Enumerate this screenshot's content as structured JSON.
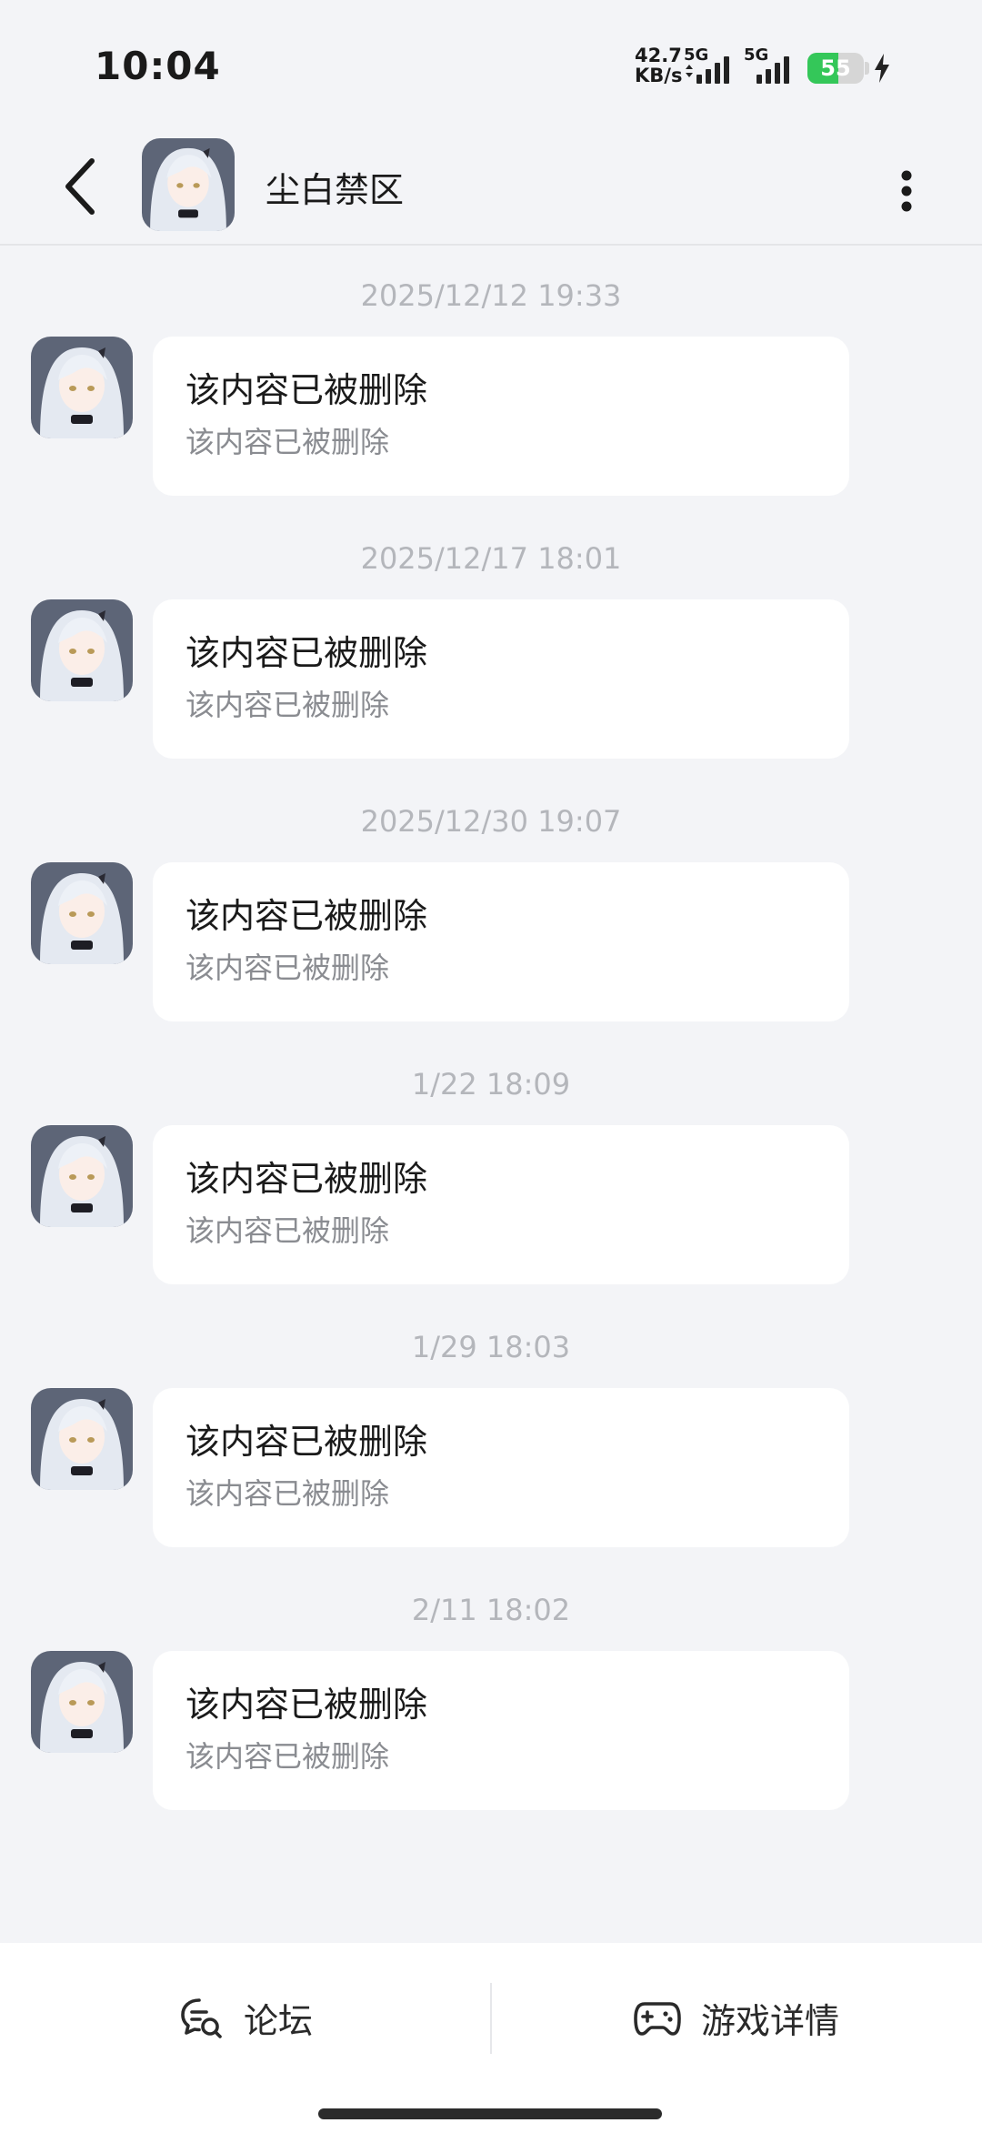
{
  "status_bar": {
    "time": "10:04",
    "net_speed_value": "42.7",
    "net_speed_unit": "KB/s",
    "signal_1_label": "5G",
    "signal_2_label": "5G",
    "battery": "55",
    "battery_level": 0.55,
    "charging": true
  },
  "header": {
    "title": "尘白禁区",
    "back_icon": "chevron-left-icon",
    "more_icon": "more-vertical-icon"
  },
  "messages": [
    {
      "time": "2025/12/12  19:33",
      "title": "该内容已被删除",
      "subtitle": "该内容已被删除"
    },
    {
      "time": "2025/12/17  18:01",
      "title": "该内容已被删除",
      "subtitle": "该内容已被删除"
    },
    {
      "time": "2025/12/30  19:07",
      "title": "该内容已被删除",
      "subtitle": "该内容已被删除"
    },
    {
      "time": "1/22  18:09",
      "title": "该内容已被删除",
      "subtitle": "该内容已被删除"
    },
    {
      "time": "1/29  18:03",
      "title": "该内容已被删除",
      "subtitle": "该内容已被删除"
    },
    {
      "time": "2/11  18:02",
      "title": "该内容已被删除",
      "subtitle": "该内容已被删除"
    }
  ],
  "bottom_bar": {
    "forum_label": "论坛",
    "forum_icon": "forum-chat-icon",
    "game_label": "游戏详情",
    "game_icon": "gamepad-icon"
  },
  "colors": {
    "background": "#f3f4f7",
    "bubble": "#ffffff",
    "battery_green": "#34c759",
    "time_gray": "#b4b6bb"
  }
}
